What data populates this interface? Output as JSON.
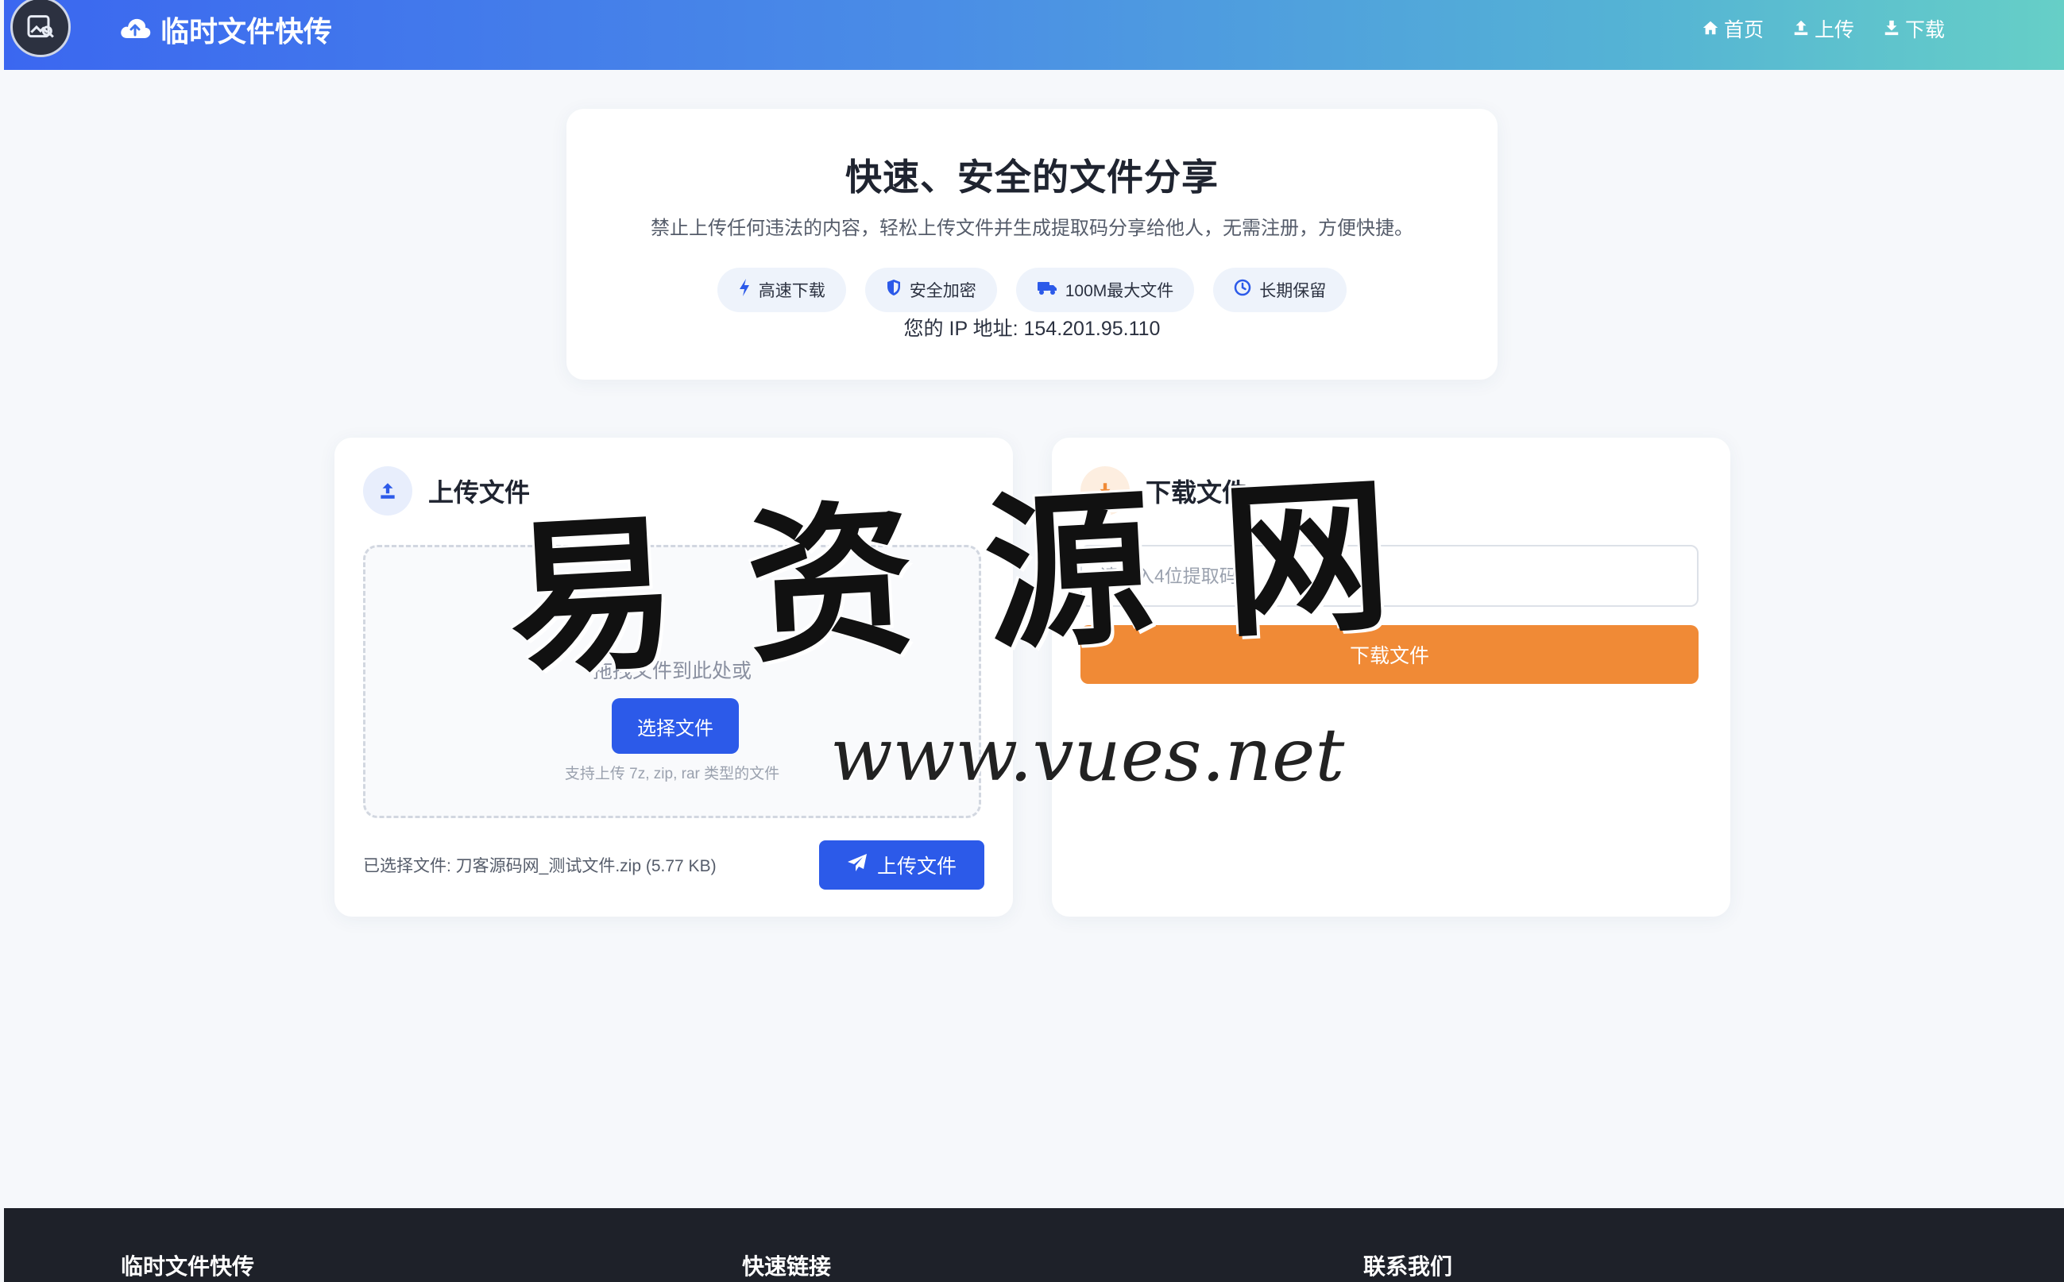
{
  "header": {
    "brand": "临时文件快传",
    "nav": [
      {
        "label": "首页",
        "icon": "home-icon"
      },
      {
        "label": "上传",
        "icon": "upload-icon"
      },
      {
        "label": "下载",
        "icon": "download-icon"
      }
    ]
  },
  "hero": {
    "title": "快速、安全的文件分享",
    "subtitle": "禁止上传任何违法的内容，轻松上传文件并生成提取码分享给他人，无需注册，方便快捷。",
    "features": [
      {
        "label": "高速下载",
        "icon": "bolt-icon"
      },
      {
        "label": "安全加密",
        "icon": "shield-icon"
      },
      {
        "label": "100M最大文件",
        "icon": "truck-icon"
      },
      {
        "label": "长期保留",
        "icon": "clock-icon"
      }
    ],
    "ip_label": "您的 IP 地址: 154.201.95.110"
  },
  "upload": {
    "title": "上传文件",
    "drop_text": "拖拽文件到此处或",
    "choose_button": "选择文件",
    "hint": "支持上传 7z, zip, rar 类型的文件",
    "selected": "已选择文件: 刀客源码网_测试文件.zip (5.77 KB)",
    "submit": "上传文件"
  },
  "download": {
    "title": "下载文件",
    "placeholder": "请输入4位提取码",
    "submit": "下载文件"
  },
  "watermark": {
    "main": "易资源网",
    "url": "www.vues.net"
  },
  "footer": {
    "cols": [
      "临时文件快传",
      "快速链接",
      "联系我们"
    ]
  },
  "colors": {
    "primary": "#2c5ae9",
    "accent_orange": "#f08a36",
    "footer_bg": "#1e2129"
  }
}
